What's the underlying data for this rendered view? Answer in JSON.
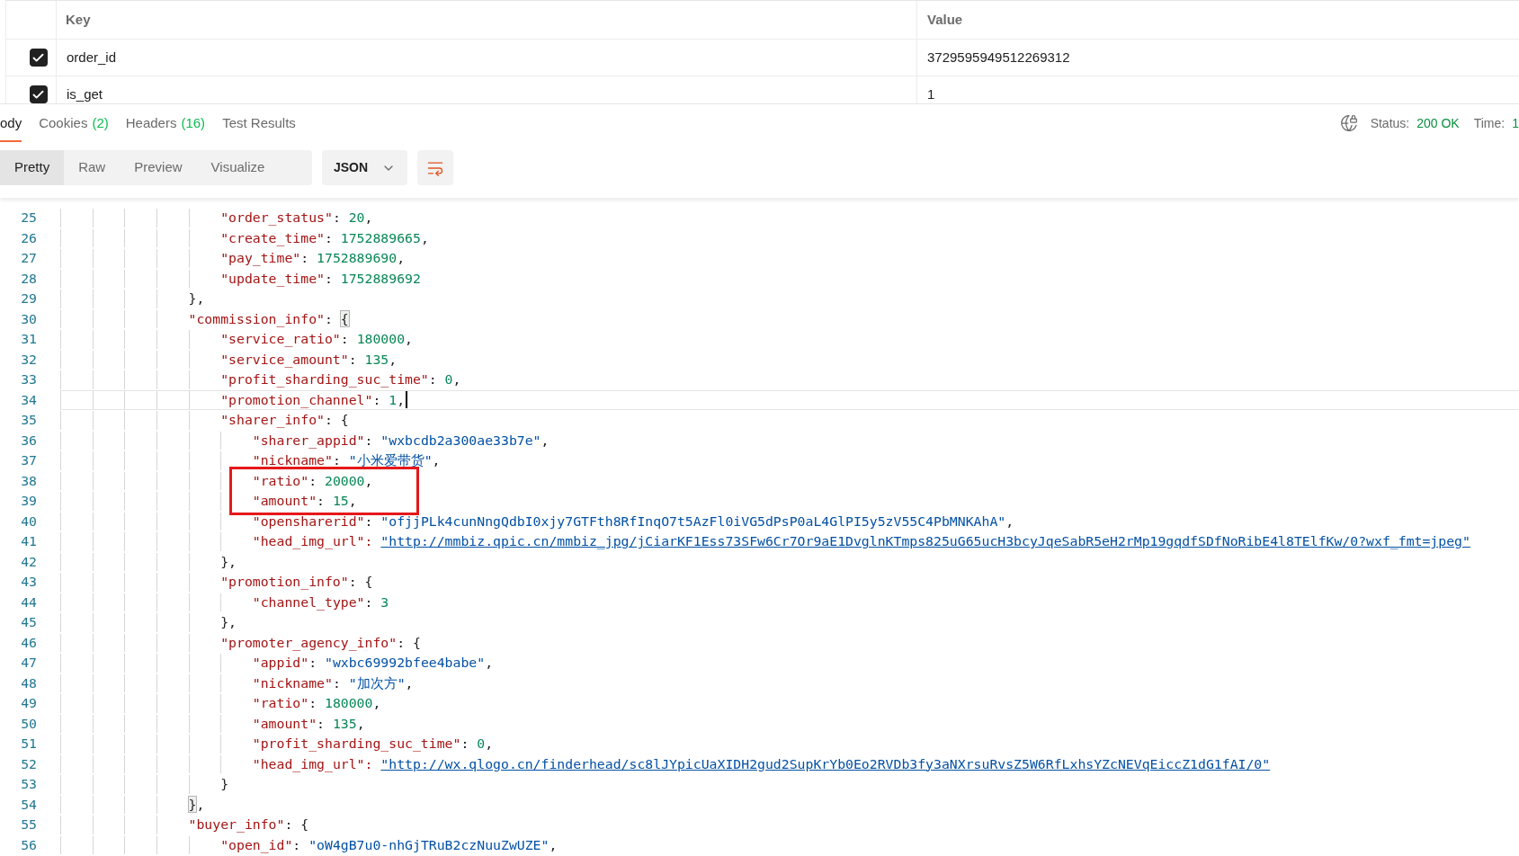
{
  "params_table": {
    "columns": [
      "Key",
      "Value"
    ],
    "rows": [
      {
        "key": "order_id",
        "value": "3729595949512269312",
        "checked": true
      },
      {
        "key": "is_get",
        "value": "1",
        "checked": true
      }
    ]
  },
  "response_tabs": [
    {
      "label": "ody",
      "selected": true
    },
    {
      "label": "Cookies",
      "count": "(2)",
      "selected": false
    },
    {
      "label": "Headers",
      "count": "(16)",
      "selected": false
    },
    {
      "label": "Test Results",
      "selected": false
    }
  ],
  "status": {
    "label": "Status:",
    "value": "200 OK"
  },
  "time": {
    "label": "Time:",
    "value": "1"
  },
  "view_modes": [
    {
      "label": "Pretty",
      "selected": true
    },
    {
      "label": "Raw",
      "selected": false
    },
    {
      "label": "Preview",
      "selected": false
    },
    {
      "label": "Visualize",
      "selected": false
    }
  ],
  "format_dropdown": "JSON",
  "code_lines": [
    {
      "children": [
        {
          "number": "25",
          "current": false,
          "boxed": false,
          "tokens": [
            {
              "kind": "key",
              "text": "\"order_status\""
            },
            {
              "kind": "punct",
              "text": ": "
            },
            {
              "kind": "number",
              "text": "20"
            },
            {
              "kind": "punct",
              "text": ","
            }
          ]
        },
        {
          "number": "26",
          "current": false,
          "boxed": false,
          "tokens": [
            {
              "kind": "key",
              "text": "\"create_time\""
            },
            {
              "kind": "punct",
              "text": ": "
            },
            {
              "kind": "number",
              "text": "1752889665"
            },
            {
              "kind": "punct",
              "text": ","
            }
          ]
        },
        {
          "number": "27",
          "current": false,
          "boxed": false,
          "tokens": [
            {
              "kind": "key",
              "text": "\"pay_time\""
            },
            {
              "kind": "punct",
              "text": ": "
            },
            {
              "kind": "number",
              "text": "1752889690"
            },
            {
              "kind": "punct",
              "text": ","
            }
          ]
        },
        {
          "number": "28",
          "current": false,
          "boxed": false,
          "tokens": [
            {
              "kind": "key",
              "text": "\"update_time\""
            },
            {
              "kind": "punct",
              "text": ": "
            },
            {
              "kind": "number",
              "text": "1752889692"
            }
          ]
        }
      ]
    },
    {
      "number": "29",
      "current": false,
      "boxed": false,
      "tokens": [
        {
          "kind": "punct",
          "text": "},"
        }
      ]
    },
    {
      "number": "30",
      "current": false,
      "boxed": false,
      "tokens": [
        {
          "kind": "key",
          "text": "\"commission_info\""
        },
        {
          "kind": "punct",
          "text": ": "
        },
        {
          "kind": "brace_match",
          "text": "{"
        }
      ],
      "children": [
        {
          "number": "31",
          "current": false,
          "boxed": false,
          "tokens": [
            {
              "kind": "key",
              "text": "\"service_ratio\""
            },
            {
              "kind": "punct",
              "text": ": "
            },
            {
              "kind": "number",
              "text": "180000"
            },
            {
              "kind": "punct",
              "text": ","
            }
          ]
        },
        {
          "number": "32",
          "current": false,
          "boxed": false,
          "tokens": [
            {
              "kind": "key",
              "text": "\"service_amount\""
            },
            {
              "kind": "punct",
              "text": ": "
            },
            {
              "kind": "number",
              "text": "135"
            },
            {
              "kind": "punct",
              "text": ","
            }
          ]
        },
        {
          "number": "33",
          "current": false,
          "boxed": false,
          "tokens": [
            {
              "kind": "key",
              "text": "\"profit_sharding_suc_time\""
            },
            {
              "kind": "punct",
              "text": ": "
            },
            {
              "kind": "number",
              "text": "0"
            },
            {
              "kind": "punct",
              "text": ","
            }
          ]
        },
        {
          "number": "34",
          "current": true,
          "boxed": false,
          "tokens": [
            {
              "kind": "key",
              "text": "\"promotion_channel\""
            },
            {
              "kind": "punct",
              "text": ": "
            },
            {
              "kind": "number",
              "text": "1"
            },
            {
              "kind": "punct",
              "text": ","
            }
          ]
        },
        {
          "number": "35",
          "current": false,
          "boxed": false,
          "tokens": [
            {
              "kind": "key",
              "text": "\"sharer_info\""
            },
            {
              "kind": "punct",
              "text": ": {"
            }
          ],
          "children": [
            {
              "number": "36",
              "current": false,
              "boxed": false,
              "tokens": [
                {
                  "kind": "key",
                  "text": "\"sharer_appid\""
                },
                {
                  "kind": "punct",
                  "text": ": "
                },
                {
                  "kind": "string",
                  "text": "\"wxbcdb2a300ae33b7e\""
                },
                {
                  "kind": "punct",
                  "text": ","
                }
              ]
            },
            {
              "number": "37",
              "current": false,
              "boxed": false,
              "tokens": [
                {
                  "kind": "key",
                  "text": "\"nickname\""
                },
                {
                  "kind": "punct",
                  "text": ": "
                },
                {
                  "kind": "string",
                  "text": "\"小米爱带货\""
                },
                {
                  "kind": "punct",
                  "text": ","
                }
              ]
            },
            {
              "number": "38",
              "current": false,
              "boxed": true,
              "tokens": [
                {
                  "kind": "key",
                  "text": "\"ratio\""
                },
                {
                  "kind": "punct",
                  "text": ": "
                },
                {
                  "kind": "number",
                  "text": "20000"
                },
                {
                  "kind": "punct",
                  "text": ","
                }
              ]
            },
            {
              "number": "39",
              "current": false,
              "boxed": true,
              "tokens": [
                {
                  "kind": "key",
                  "text": "\"amount\""
                },
                {
                  "kind": "punct",
                  "text": ": "
                },
                {
                  "kind": "number",
                  "text": "15"
                },
                {
                  "kind": "punct",
                  "text": ","
                }
              ]
            },
            {
              "number": "40",
              "current": false,
              "boxed": false,
              "tokens": [
                {
                  "kind": "key",
                  "text": "\"opensharerid\""
                },
                {
                  "kind": "punct",
                  "text": ": "
                },
                {
                  "kind": "string",
                  "text": "\"ofjjPLk4cunNngQdbI0xjy7GTFth8RfInqO7t5AzFl0iVG5dPsP0aL4GlPI5y5zV55C4PbMNKAhA\""
                },
                {
                  "kind": "punct",
                  "text": ","
                }
              ]
            },
            {
              "number": "41",
              "current": false,
              "boxed": false,
              "tokens": [
                {
                  "kind": "key",
                  "text": "\"head_img_url\": "
                },
                {
                  "kind": "link",
                  "text": "\"http://mmbiz.qpic.cn/mmbiz_jpg/jCiarKF1Ess73SFw6Cr7Or9aE1DvglnKTmps825uG65ucH3bcyJqeSabR5eH2rMp19gqdfSDfNoRibE4l8TElfKw/0?wxf_fmt=jpeg\""
                }
              ]
            }
          ]
        },
        {
          "number": "42",
          "current": false,
          "boxed": false,
          "tokens": [
            {
              "kind": "punct",
              "text": "},"
            }
          ]
        },
        {
          "number": "43",
          "current": false,
          "boxed": false,
          "tokens": [
            {
              "kind": "key",
              "text": "\"promotion_info\""
            },
            {
              "kind": "punct",
              "text": ": {"
            }
          ],
          "children": [
            {
              "number": "44",
              "current": false,
              "boxed": false,
              "tokens": [
                {
                  "kind": "key",
                  "text": "\"channel_type\""
                },
                {
                  "kind": "punct",
                  "text": ": "
                },
                {
                  "kind": "number",
                  "text": "3"
                }
              ]
            }
          ]
        },
        {
          "number": "45",
          "current": false,
          "boxed": false,
          "tokens": [
            {
              "kind": "punct",
              "text": "},"
            }
          ]
        },
        {
          "number": "46",
          "current": false,
          "boxed": false,
          "tokens": [
            {
              "kind": "key",
              "text": "\"promoter_agency_info\""
            },
            {
              "kind": "punct",
              "text": ": {"
            }
          ],
          "children": [
            {
              "number": "47",
              "current": false,
              "boxed": false,
              "tokens": [
                {
                  "kind": "key",
                  "text": "\"appid\""
                },
                {
                  "kind": "punct",
                  "text": ": "
                },
                {
                  "kind": "string",
                  "text": "\"wxbc69992bfee4babe\""
                },
                {
                  "kind": "punct",
                  "text": ","
                }
              ]
            },
            {
              "number": "48",
              "current": false,
              "boxed": false,
              "tokens": [
                {
                  "kind": "key",
                  "text": "\"nickname\""
                },
                {
                  "kind": "punct",
                  "text": ": "
                },
                {
                  "kind": "string",
                  "text": "\"加次方\""
                },
                {
                  "kind": "punct",
                  "text": ","
                }
              ]
            },
            {
              "number": "49",
              "current": false,
              "boxed": false,
              "tokens": [
                {
                  "kind": "key",
                  "text": "\"ratio\""
                },
                {
                  "kind": "punct",
                  "text": ": "
                },
                {
                  "kind": "number",
                  "text": "180000"
                },
                {
                  "kind": "punct",
                  "text": ","
                }
              ]
            },
            {
              "number": "50",
              "current": false,
              "boxed": false,
              "tokens": [
                {
                  "kind": "key",
                  "text": "\"amount\""
                },
                {
                  "kind": "punct",
                  "text": ": "
                },
                {
                  "kind": "number",
                  "text": "135"
                },
                {
                  "kind": "punct",
                  "text": ","
                }
              ]
            },
            {
              "number": "51",
              "current": false,
              "boxed": false,
              "tokens": [
                {
                  "kind": "key",
                  "text": "\"profit_sharding_suc_time\""
                },
                {
                  "kind": "punct",
                  "text": ": "
                },
                {
                  "kind": "number",
                  "text": "0"
                },
                {
                  "kind": "punct",
                  "text": ","
                }
              ]
            },
            {
              "number": "52",
              "current": false,
              "boxed": false,
              "tokens": [
                {
                  "kind": "key",
                  "text": "\"head_img_url\": "
                },
                {
                  "kind": "link",
                  "text": "\"http://wx.qlogo.cn/finderhead/sc8lJYpicUaXIDH2gud2SupKrYb0Eo2RVDb3fy3aNXrsuRvsZ5W6RfLxhsYZcNEVqEiccZ1dG1fAI/0\""
                }
              ]
            }
          ]
        },
        {
          "number": "53",
          "current": false,
          "boxed": false,
          "tokens": [
            {
              "kind": "punct",
              "text": "}"
            }
          ]
        }
      ]
    },
    {
      "number": "54",
      "current": false,
      "boxed": false,
      "tokens": [
        {
          "kind": "brace_match",
          "text": "}"
        },
        {
          "kind": "punct",
          "text": ","
        }
      ]
    },
    {
      "number": "55",
      "current": false,
      "boxed": false,
      "tokens": [
        {
          "kind": "key",
          "text": "\"buyer_info\""
        },
        {
          "kind": "punct",
          "text": ": {"
        }
      ],
      "children": [
        {
          "number": "56",
          "current": false,
          "boxed": false,
          "tokens": [
            {
              "kind": "key",
              "text": "\"open_id\""
            },
            {
              "kind": "punct",
              "text": ": "
            },
            {
              "kind": "string",
              "text": "\"oW4gB7u0-nhGjTRuB2czNuuZwUZE\""
            },
            {
              "kind": "punct",
              "text": ","
            }
          ]
        }
      ]
    }
  ]
}
